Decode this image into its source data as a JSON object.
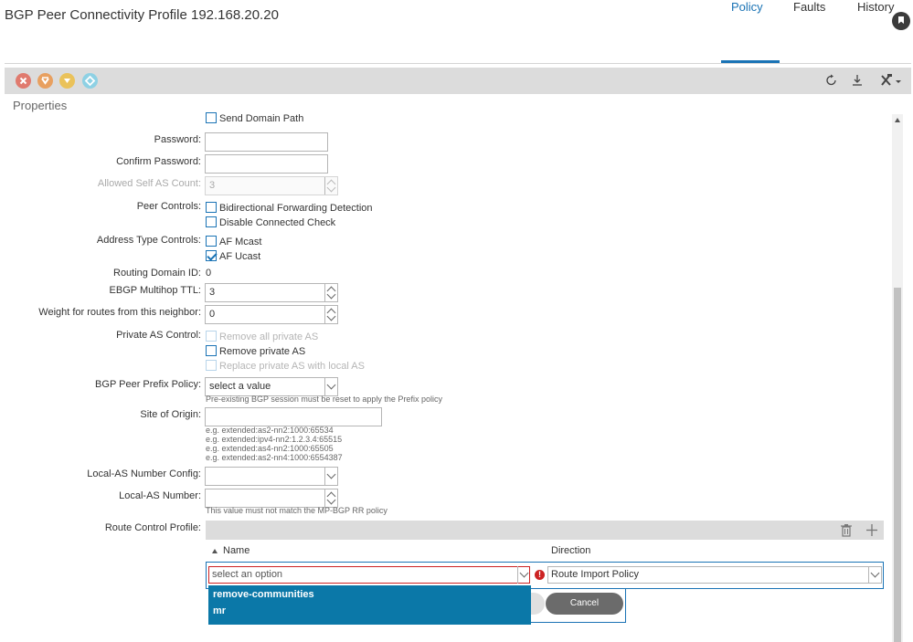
{
  "header": {
    "title": "BGP Peer Connectivity Profile 192.168.20.20"
  },
  "tabs": [
    {
      "label": "Policy"
    },
    {
      "label": "Faults"
    },
    {
      "label": "History"
    }
  ],
  "colors": {
    "accent": "#1a73b5",
    "critical": "#e07a6e",
    "major": "#e8a060",
    "minor": "#eac25a",
    "warning": "#8ed1e4",
    "error": "#cc2222",
    "dropdown_bg": "#0b78a8"
  },
  "toolbar": {
    "severity_icons": [
      "critical-fault-icon",
      "major-fault-icon",
      "minor-fault-icon",
      "warning-fault-icon"
    ],
    "actions": [
      "refresh-icon",
      "download-icon",
      "tools-icon"
    ]
  },
  "section_label": "Properties",
  "form": {
    "send_domain_path": "Send Domain Path",
    "password_label": "Password:",
    "password_value": "",
    "confirm_password_label": "Confirm Password:",
    "confirm_password_value": "",
    "allowed_self_as_label": "Allowed Self AS Count:",
    "allowed_self_as_value": "3",
    "peer_controls_label": "Peer Controls:",
    "peer_controls": [
      {
        "label": "Bidirectional Forwarding Detection",
        "checked": false
      },
      {
        "label": "Disable Connected Check",
        "checked": false
      }
    ],
    "address_type_label": "Address Type Controls:",
    "address_types": [
      {
        "label": "AF Mcast",
        "checked": false
      },
      {
        "label": "AF Ucast",
        "checked": true
      }
    ],
    "routing_domain_label": "Routing Domain ID:",
    "routing_domain_value": "0",
    "ebgp_ttl_label": "EBGP Multihop TTL:",
    "ebgp_ttl_value": "3",
    "weight_label": "Weight for routes from this neighbor:",
    "weight_value": "0",
    "private_as_label": "Private AS Control:",
    "private_as": [
      {
        "label": "Remove all private AS",
        "checked": false,
        "disabled": true
      },
      {
        "label": "Remove private AS",
        "checked": false,
        "disabled": false
      },
      {
        "label": "Replace private AS with local AS",
        "checked": false,
        "disabled": true
      }
    ],
    "prefix_policy_label": "BGP Peer Prefix Policy:",
    "prefix_policy_value": "select a value",
    "prefix_policy_hint": "Pre-existing BGP session must be reset to apply the Prefix policy",
    "site_origin_label": "Site of Origin:",
    "site_origin_value": "",
    "site_origin_hints": [
      "e.g. extended:as2-nn2:1000:65534",
      "e.g. extended:ipv4-nn2:1.2.3.4:65515",
      "e.g. extended:as4-nn2:1000:65505",
      "e.g. extended:as2-nn4:1000:6554387"
    ],
    "local_as_config_label": "Local-AS Number Config:",
    "local_as_config_value": "",
    "local_as_number_label": "Local-AS Number:",
    "local_as_number_value": "",
    "local_as_number_hint": "This value must not match the MP-BGP RR policy",
    "route_control_label": "Route Control Profile:"
  },
  "route_control": {
    "columns": [
      "Name",
      "Direction"
    ],
    "name_placeholder": "select an option",
    "direction_value": "Route Import Policy",
    "error_glyph": "!",
    "options": [
      "remove-communities",
      "mr"
    ],
    "cancel_label": "Cancel"
  }
}
